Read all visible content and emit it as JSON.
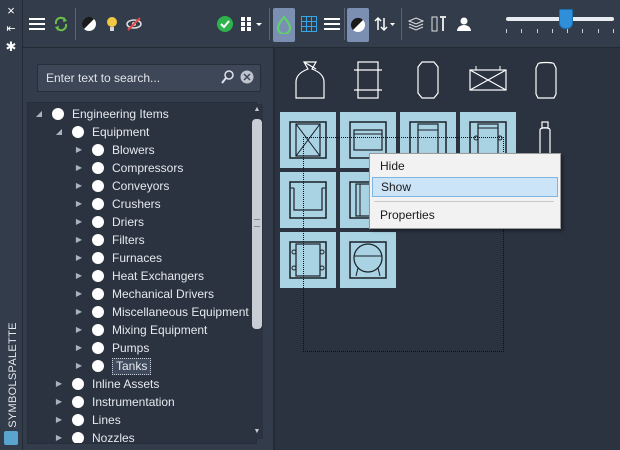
{
  "sidebar": {
    "title": "SYMBOLSPALETTE",
    "close_icon": "×",
    "pin_icon": "⇤",
    "settings_icon": "✱"
  },
  "toolbar": {
    "icons": [
      "menu-icon",
      "refresh-icon",
      "contrast-icon",
      "lightbulb-icon",
      "hide-icon",
      "check-icon",
      "grid-dropdown-icon",
      "symbol-set-icon",
      "table-view-icon",
      "list-view-icon",
      "theme-icon",
      "sort-icon",
      "layers-icon",
      "text-icon",
      "user-icon"
    ],
    "slider": {
      "value": 0.55
    }
  },
  "search": {
    "placeholder": "Enter text to search..."
  },
  "tree": [
    {
      "label": "Engineering Items",
      "level": 0,
      "expanded": true
    },
    {
      "label": "Equipment",
      "level": 1,
      "expanded": true
    },
    {
      "label": "Blowers",
      "level": 2
    },
    {
      "label": "Compressors",
      "level": 2
    },
    {
      "label": "Conveyors",
      "level": 2
    },
    {
      "label": "Crushers",
      "level": 2
    },
    {
      "label": "Driers",
      "level": 2
    },
    {
      "label": "Filters",
      "level": 2
    },
    {
      "label": "Furnaces",
      "level": 2
    },
    {
      "label": "Heat Exchangers",
      "level": 2
    },
    {
      "label": "Mechanical Drivers",
      "level": 2
    },
    {
      "label": "Miscellaneous Equipment",
      "level": 2
    },
    {
      "label": "Mixing Equipment",
      "level": 2
    },
    {
      "label": "Pumps",
      "level": 2
    },
    {
      "label": "Tanks",
      "level": 2,
      "selected": true
    },
    {
      "label": "Inline Assets",
      "level": 1
    },
    {
      "label": "Instrumentation",
      "level": 1
    },
    {
      "label": "Lines",
      "level": 1
    },
    {
      "label": "Nozzles",
      "level": 1
    }
  ],
  "context_menu": {
    "items": [
      "Hide",
      "Show",
      "Properties"
    ],
    "hovered": "Show"
  },
  "colors": {
    "highlight": "#a9d3e3",
    "accent": "#2f8fd8",
    "panel": "#333c4a",
    "background": "#2b3340"
  }
}
